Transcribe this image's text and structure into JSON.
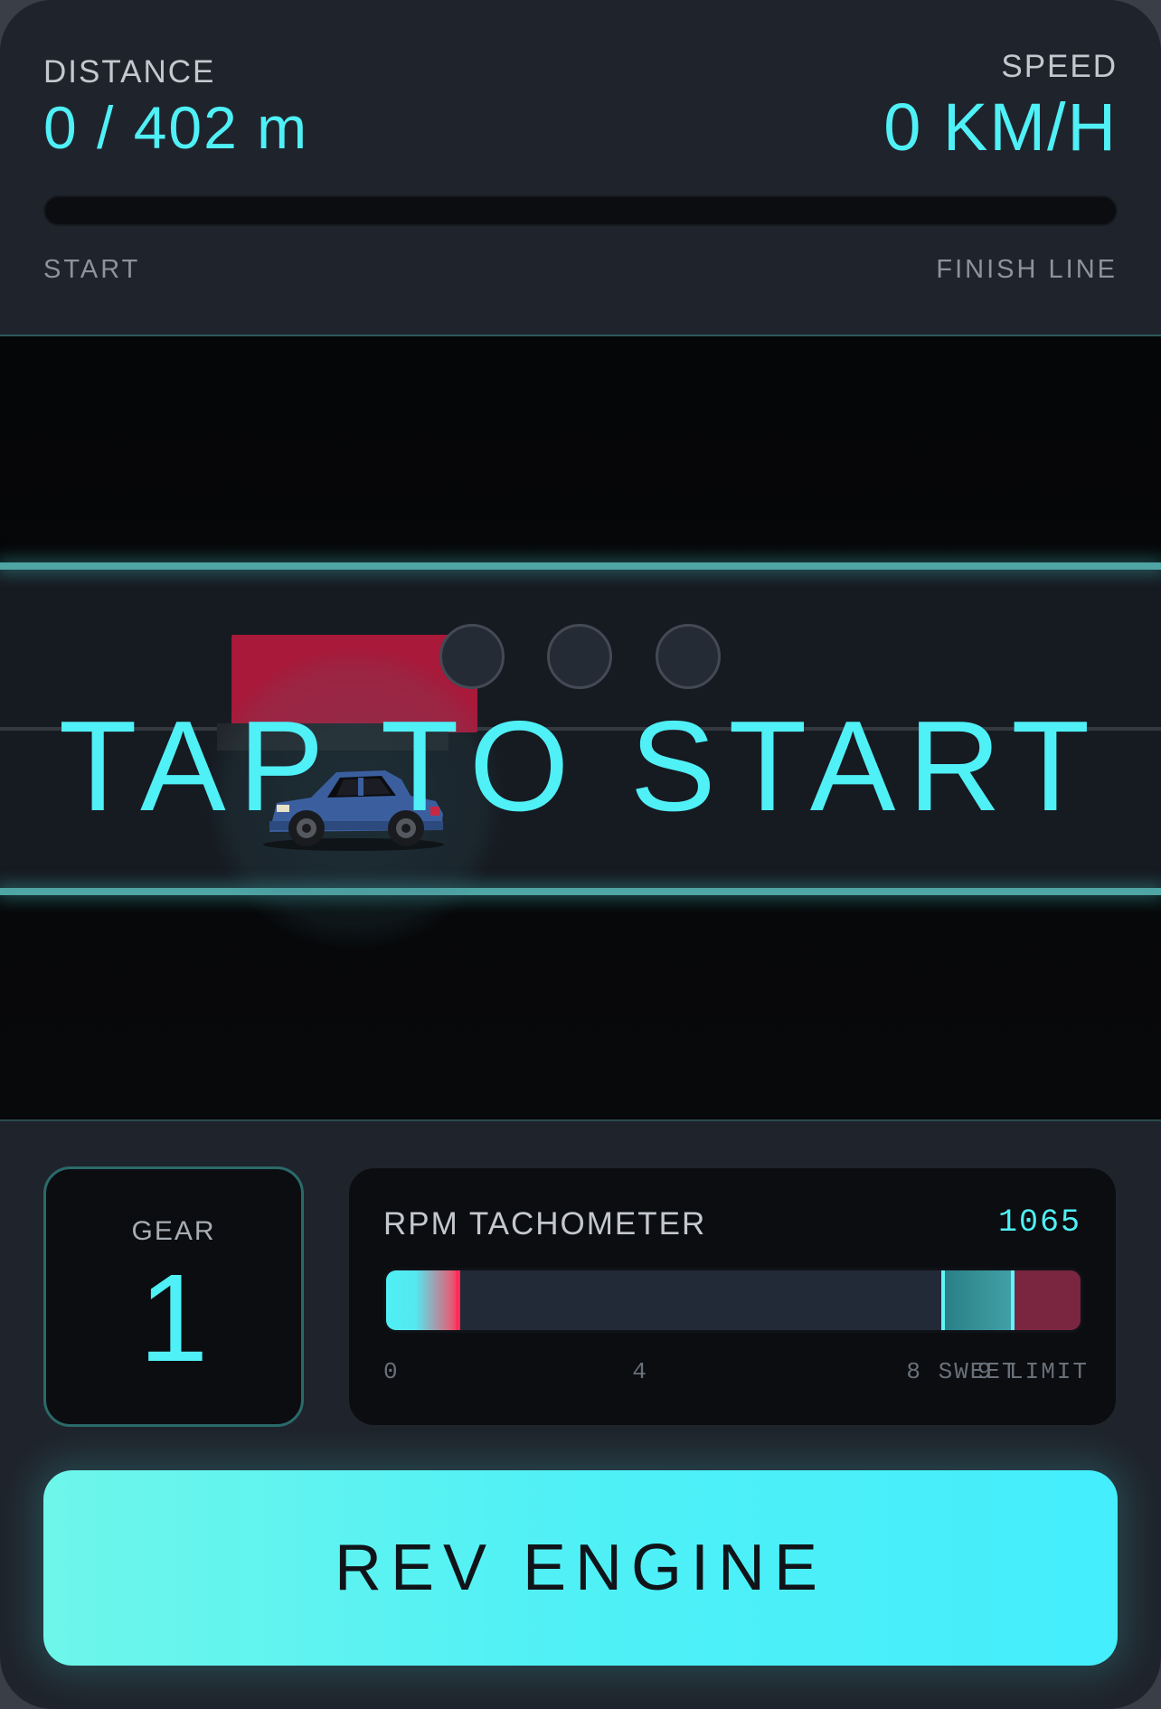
{
  "hud": {
    "distance_label": "DISTANCE",
    "distance_value": "0 / 402 m",
    "speed_label": "SPEED",
    "speed_value": "0 KM/H",
    "progress_fraction": 0,
    "start_label": "START",
    "finish_label": "FINISH LINE"
  },
  "track": {
    "overlay_text": "TAP TO START",
    "start_lights": [
      "off",
      "off",
      "off"
    ]
  },
  "gear": {
    "label": "GEAR",
    "value": "1"
  },
  "tach": {
    "label": "RPM TACHOMETER",
    "rpm_value": "1065",
    "max_rpm_k": 10,
    "current_rpm_k": 1.065,
    "sweet_start_k": 8,
    "limit_start_k": 9,
    "ticks": [
      {
        "k": 0,
        "label": "0"
      },
      {
        "k": 4,
        "label": "4"
      },
      {
        "k": 8,
        "label": "8 SWEET"
      },
      {
        "k": 9,
        "label": "9 LIMIT"
      }
    ]
  },
  "rev_button_label": "REV ENGINE",
  "colors": {
    "accent": "#4ff0f6",
    "danger": "#ff2d5a",
    "opponent": "#a8193a",
    "player_car": "#3b5f9e"
  },
  "icons": {
    "player_car": "car-icon"
  }
}
